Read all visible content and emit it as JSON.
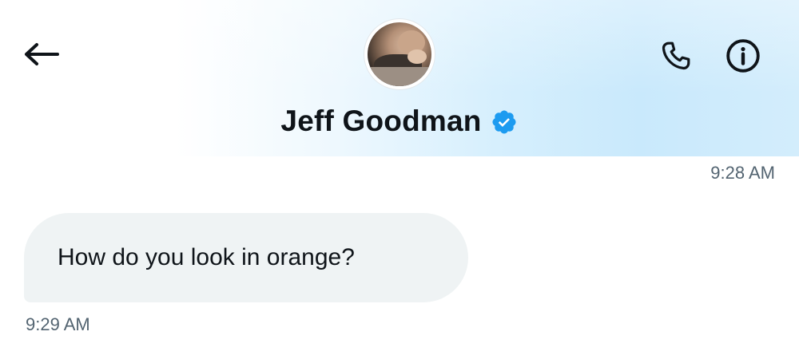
{
  "header": {
    "contact_name": "Jeff Goodman",
    "verified": true,
    "accent_color": "#1d9bf0",
    "icons": {
      "back": "arrow-left-icon",
      "call": "phone-icon",
      "info": "info-icon",
      "verified": "verified-badge-icon"
    }
  },
  "messages": [
    {
      "direction": "sent",
      "timestamp": "9:28 AM"
    },
    {
      "direction": "received",
      "text": "How do you look in orange?",
      "timestamp": "9:29 AM",
      "bubble_color": "#eff3f4"
    }
  ]
}
